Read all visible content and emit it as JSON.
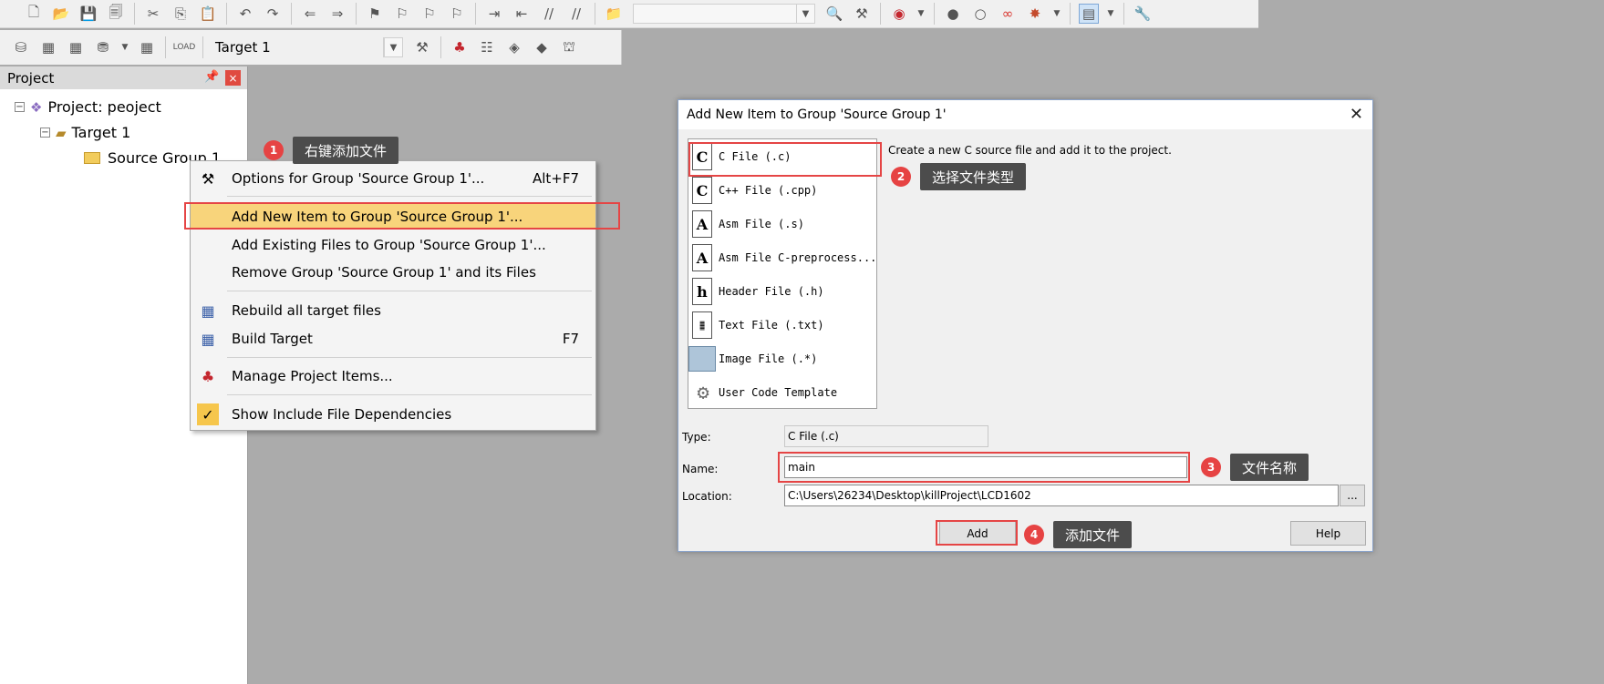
{
  "toolbar2": {
    "target_combo": "Target 1"
  },
  "project_panel": {
    "title": "Project",
    "pin_icon": "pin-icon",
    "close": "×",
    "tree": {
      "project": "Project: peoject",
      "target": "Target 1",
      "group": "Source Group 1"
    }
  },
  "context_menu": {
    "items": [
      {
        "label": "Options for Group 'Source Group 1'...",
        "shortcut": "Alt+F7",
        "icon": "magic-wand-icon"
      },
      {
        "label": "Add New  Item to Group 'Source Group 1'...",
        "shortcut": ""
      },
      {
        "label": "Add Existing Files to Group 'Source Group 1'...",
        "shortcut": ""
      },
      {
        "label": "Remove Group 'Source Group 1' and its Files",
        "shortcut": ""
      },
      {
        "label": "Rebuild all target files",
        "shortcut": "",
        "icon": "rebuild-icon"
      },
      {
        "label": "Build Target",
        "shortcut": "F7",
        "icon": "build-icon"
      },
      {
        "label": "Manage Project Items...",
        "shortcut": "",
        "icon": "manage-items-icon"
      },
      {
        "label": "Show Include File Dependencies",
        "shortcut": "",
        "icon": "checkmark-icon",
        "checked": true
      }
    ]
  },
  "callouts": [
    {
      "num": "1",
      "text": "右键添加文件"
    },
    {
      "num": "2",
      "text": "选择文件类型"
    },
    {
      "num": "3",
      "text": "文件名称"
    },
    {
      "num": "4",
      "text": "添加文件"
    }
  ],
  "dialog": {
    "title": "Add New Item to Group 'Source Group 1'",
    "close": "✕",
    "file_types": [
      {
        "label": "C File (.c)",
        "icon_letter": "C"
      },
      {
        "label": "C++ File (.cpp)",
        "icon_letter": "C"
      },
      {
        "label": "Asm File (.s)",
        "icon_letter": "A"
      },
      {
        "label": "Asm File C-preprocess...",
        "icon_letter": "A"
      },
      {
        "label": "Header File (.h)",
        "icon_letter": "h"
      },
      {
        "label": "Text File (.txt)",
        "icon_letter": ""
      },
      {
        "label": "Image File (.*)",
        "icon_letter": ""
      },
      {
        "label": "User Code Template",
        "icon_letter": ""
      }
    ],
    "description": "Create a new C source file and add it to the project.",
    "type_label": "Type:",
    "type_value": "C File (.c)",
    "name_label": "Name:",
    "name_value": "main",
    "location_label": "Location:",
    "location_value": "C:\\Users\\26234\\Desktop\\killProject\\LCD1602",
    "browse_label": "...",
    "add_label": "Add",
    "help_label": "Help"
  }
}
